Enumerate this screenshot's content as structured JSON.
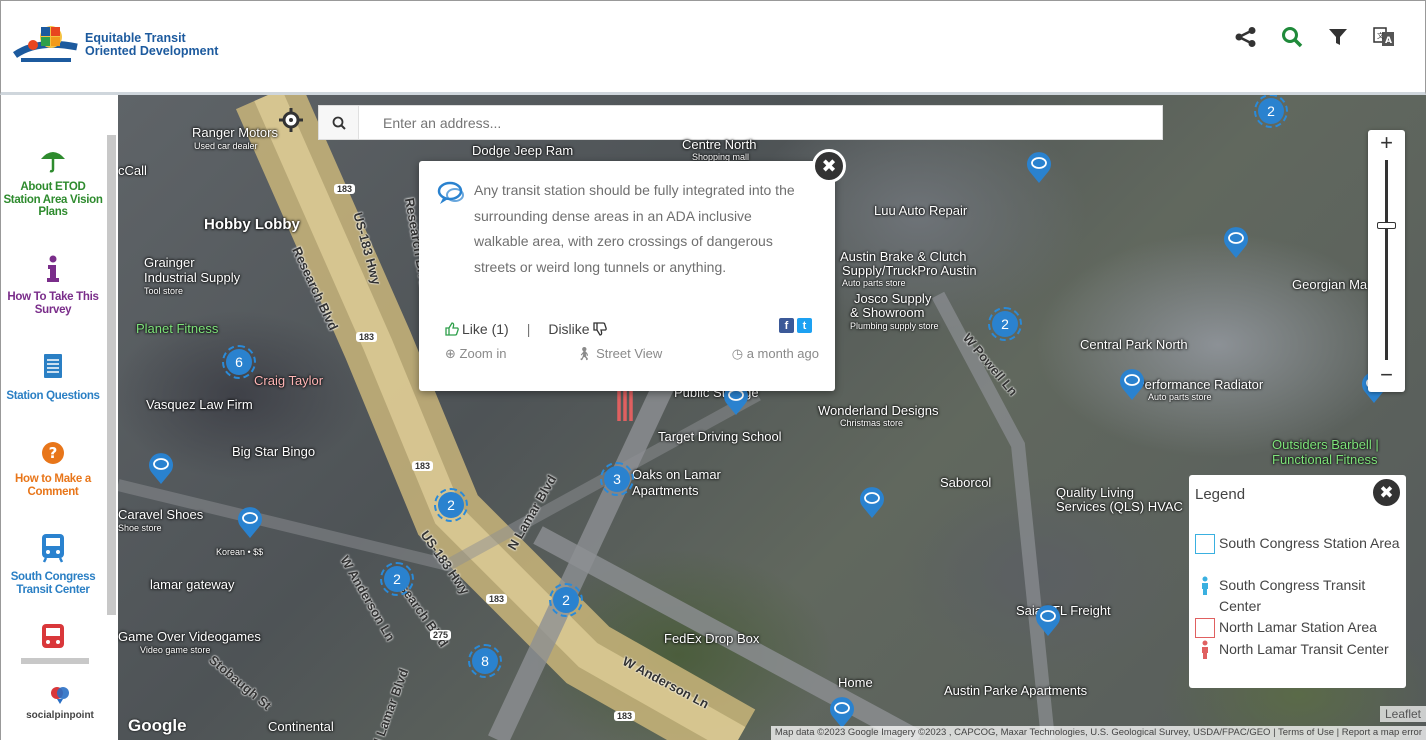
{
  "header": {
    "logo_line1": "Equitable Transit",
    "logo_line2": "Oriented Development",
    "icons": [
      "share-icon",
      "search-icon",
      "filter-icon",
      "translate-icon"
    ]
  },
  "sidebar": {
    "items": [
      {
        "label": "About ETOD Station Area Vision Plans",
        "icon": "umbrella-icon",
        "color": "#2e8b2e"
      },
      {
        "label": "How To Take This Survey",
        "icon": "info-icon",
        "color": "#7a2d8a"
      },
      {
        "label": "Station Questions",
        "icon": "document-icon",
        "color": "#2a7fc4"
      },
      {
        "label": "How to Make a Comment",
        "icon": "question-icon",
        "color": "#e8761a"
      },
      {
        "label": "South Congress Transit Center",
        "icon": "bus-icon",
        "color": "#2a82cf"
      },
      {
        "label": "",
        "icon": "train-icon",
        "color": "#d9373a"
      }
    ],
    "brand": "socialpinpoint"
  },
  "map": {
    "search_placeholder": "Enter an address...",
    "labels": [
      "Ranger Motors",
      "Used car dealer",
      "Dodge Jeep Ram",
      "Centre North",
      "Shopping mall",
      "Hobby Lobby",
      "Grainger",
      "Industrial Supply",
      "Tool store",
      "Planet Fitness",
      "Craig Taylor",
      "Vasquez Law Firm",
      "Big Star Bingo",
      "Luu Auto Repair",
      "Austin Brake & Clutch",
      "Supply/TruckPro Austin",
      "Auto parts store",
      "Josco Supply",
      "& Showroom",
      "Plumbing supply store",
      "Central Park North",
      "Performance Radiator",
      "Auto parts store",
      "Georgian Ma",
      "Wonderland Designs",
      "Christmas store",
      "Target Driving School",
      "Oaks on Lamar",
      "Apartments",
      "Saborcol",
      "Quality Living",
      "Services (QLS) HVAC",
      "Outsiders Barbell |",
      "Functional Fitness",
      "Caravel Shoes",
      "Shoe store",
      "Korean • $$",
      "lamar gateway",
      "Game Over Videogames",
      "Video game store",
      "FedEx Drop Box",
      "Saia LTL Freight",
      "Home",
      "Austin Parke Apartments",
      "Public Storage",
      "cCall",
      "Continental"
    ],
    "roads": [
      "Research Blvd",
      "US-183 Hwy",
      "Research Blvd",
      "W Powell Ln",
      "N Lamar Blvd",
      "US-183 Hwy",
      "W Anderson Ln",
      "Research Blvd",
      "W Anderson Ln",
      "Stobaugh St",
      "N Lamar Blvd"
    ],
    "shields": [
      "183",
      "183",
      "183",
      "183",
      "275",
      "183"
    ],
    "clusters": [
      "6",
      "2",
      "3",
      "2",
      "2",
      "2",
      "8",
      "2"
    ],
    "attribution": "Map data ©2023 Google Imagery ©2023 , CAPCOG, Maxar Technologies, U.S. Geological Survey, USDA/FPAC/GEO",
    "terms": "Terms of Use",
    "report": "Report a map error",
    "leaflet": "Leaflet",
    "google": "Google"
  },
  "popup": {
    "comment": "Any transit station should be fully integrated into the surrounding dense areas in an ADA inclusive walkable area, with zero crossings of dangerous streets or weird long tunnels or anything.",
    "like_label": "Like (1)",
    "separator": "|",
    "dislike_label": "Dislike",
    "zoom_label": "Zoom in",
    "street_label": "Street View",
    "time_label": "a month ago",
    "close": "✖",
    "facebook": "f",
    "twitter": "t"
  },
  "zoom": {
    "plus": "+",
    "minus": "−"
  },
  "legend": {
    "title": "Legend",
    "close": "✖",
    "items": [
      {
        "label": "South Congress Station Area",
        "kind": "area",
        "color": "#3ab0e0"
      },
      {
        "label": "South Congress Transit Center",
        "kind": "person",
        "color": "#3ab0e0"
      },
      {
        "label": "North Lamar Station Area",
        "kind": "area",
        "color": "#e06060"
      },
      {
        "label": "North Lamar Transit Center",
        "kind": "person",
        "color": "#e06060"
      }
    ]
  }
}
